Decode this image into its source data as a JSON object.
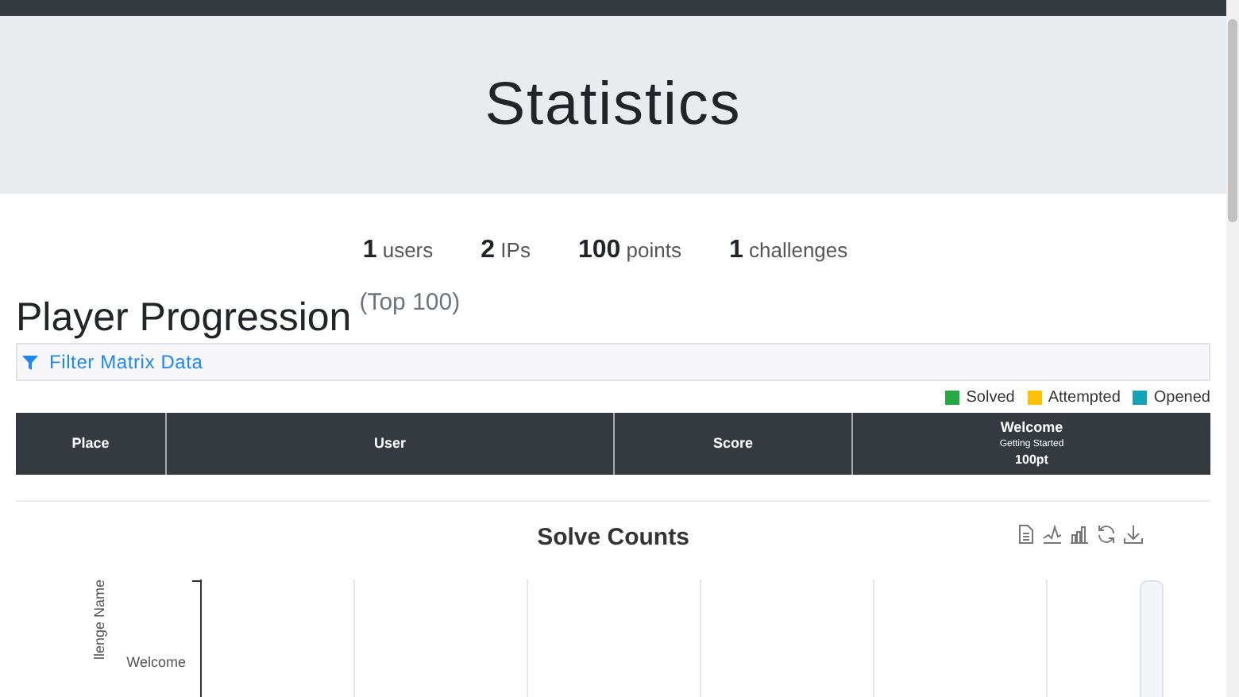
{
  "page_title": "Statistics",
  "stats": [
    {
      "value": "1",
      "label": "users"
    },
    {
      "value": "2",
      "label": "IPs"
    },
    {
      "value": "100",
      "label": "points"
    },
    {
      "value": "1",
      "label": "challenges"
    }
  ],
  "section": {
    "title": "Player Progression",
    "note": "(Top 100)"
  },
  "filter": {
    "label": "Filter Matrix Data"
  },
  "legend": [
    {
      "label": "Solved",
      "color": "#28a745"
    },
    {
      "label": "Attempted",
      "color": "#ffc107"
    },
    {
      "label": "Opened",
      "color": "#17a2b8"
    }
  ],
  "matrix": {
    "columns": [
      {
        "kind": "plain",
        "label": "Place"
      },
      {
        "kind": "plain",
        "label": "User"
      },
      {
        "kind": "plain",
        "label": "Score"
      },
      {
        "kind": "challenge",
        "label": "Welcome",
        "category": "Getting Started",
        "points": "100pt"
      }
    ]
  },
  "chart": {
    "title": "Solve Counts",
    "axis_label": "llenge Name",
    "category": "Welcome"
  }
}
